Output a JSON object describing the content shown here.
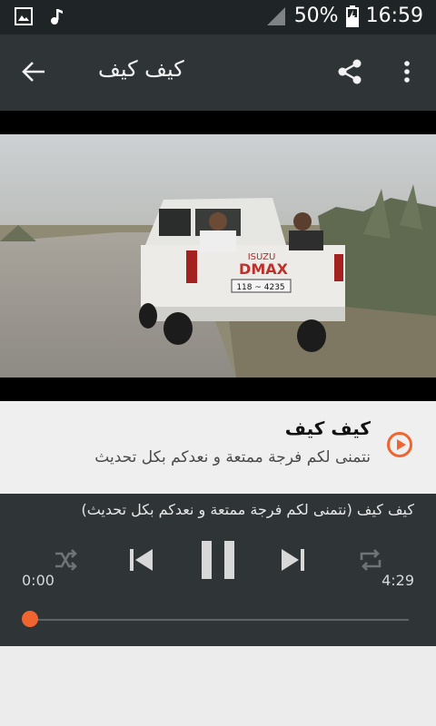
{
  "status": {
    "battery": "50%",
    "time": "16:59"
  },
  "appbar": {
    "title": "كيف كيف"
  },
  "video": {
    "plate": "118 ~ 4235",
    "brand": "DMAX",
    "maker": "ISUZU"
  },
  "track": {
    "title": "كيف كيف",
    "subtitle": "نتمنى لكم فرجة ممتعة و نعدكم بكل تحديث"
  },
  "player": {
    "now_playing": "كيف كيف (نتمنى لكم فرجة ممتعة و نعدكم بكل تحديث)",
    "elapsed": "0:00",
    "duration": "4:29",
    "progress": 0
  },
  "colors": {
    "accent": "#f0642f",
    "bar": "#2f3537",
    "status": "#1f2527"
  },
  "icons": [
    "image-icon",
    "music-note-icon",
    "signal-icon",
    "battery-icon",
    "back-arrow-icon",
    "share-icon",
    "more-vert-icon",
    "play-circle-icon",
    "shuffle-icon",
    "previous-icon",
    "pause-icon",
    "next-icon",
    "repeat-icon"
  ]
}
